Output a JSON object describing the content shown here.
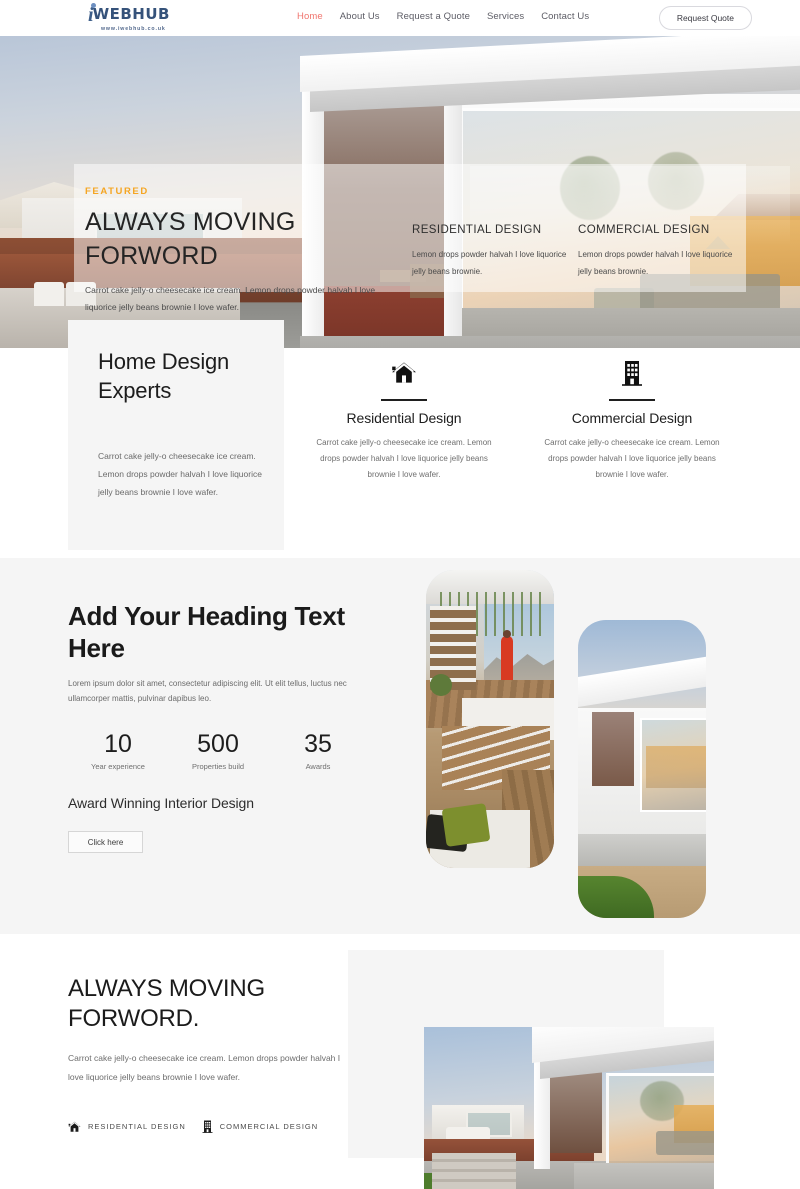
{
  "navbar": {
    "logo": {
      "mark": "i",
      "word": "WEBHUB",
      "url": "www.iwebhub.co.uk"
    },
    "links": [
      {
        "label": "Home",
        "active": true
      },
      {
        "label": "About Us",
        "active": false
      },
      {
        "label": "Request a Quote",
        "active": false
      },
      {
        "label": "Services",
        "active": false
      },
      {
        "label": "Contact Us",
        "active": false
      }
    ],
    "cta_label": "Request Quote",
    "accent_color": "#f0756e"
  },
  "hero": {
    "eyebrow": "FEATURED",
    "eyebrow_color": "#f5a623",
    "title": "ALWAYS MOVING FORWORD",
    "subtitle": "Carrot cake jelly-o cheesecake ice cream. Lemon drops powder halvah I love liquorice jelly beans brownie I love wafer.",
    "cards": [
      {
        "title": "RESIDENTIAL DESIGN",
        "text": "Lemon drops powder halvah I love liquorice jelly beans brownie."
      },
      {
        "title": "COMMERCIAL DESIGN",
        "text": "Lemon drops powder halvah I love liquorice jelly beans brownie."
      }
    ]
  },
  "experts": {
    "title": "Home Design Experts",
    "text": "Carrot cake jelly-o cheesecake ice cream. Lemon drops powder halvah I love liquorice jelly beans brownie I love wafer.",
    "features": [
      {
        "icon": "house-icon",
        "title": "Residential Design",
        "text": "Carrot cake jelly-o cheesecake ice cream. Lemon drops powder halvah I love liquorice jelly beans brownie I love wafer."
      },
      {
        "icon": "building-icon",
        "title": "Commercial Design",
        "text": "Carrot cake jelly-o cheesecake ice cream. Lemon drops powder halvah I love liquorice jelly beans brownie I love wafer."
      }
    ]
  },
  "stats_section": {
    "heading": "Add Your Heading Text Here",
    "lede": "Lorem ipsum dolor sit amet, consectetur adipiscing elit. Ut elit tellus, luctus nec ullamcorper mattis, pulvinar dapibus leo.",
    "stats": [
      {
        "value": "10",
        "label": "Year experience"
      },
      {
        "value": "500",
        "label": "Properties build"
      },
      {
        "value": "35",
        "label": "Awards"
      }
    ],
    "award_line": "Award Winning Interior Design",
    "button_label": "Click here",
    "image_a_alt": "interior terrace with person in red",
    "image_b_alt": "modern white house exterior"
  },
  "last_section": {
    "title": "ALWAYS MOVING FORWORD.",
    "text": "Carrot cake jelly-o cheesecake ice cream. Lemon drops powder halvah I love liquorice jelly beans brownie I love wafer.",
    "tags": [
      {
        "icon": "house-icon",
        "label": "RESIDENTIAL DESIGN"
      },
      {
        "icon": "building-icon",
        "label": "COMMERCIAL DESIGN"
      }
    ],
    "image_alt": "modern white villa at dusk"
  }
}
